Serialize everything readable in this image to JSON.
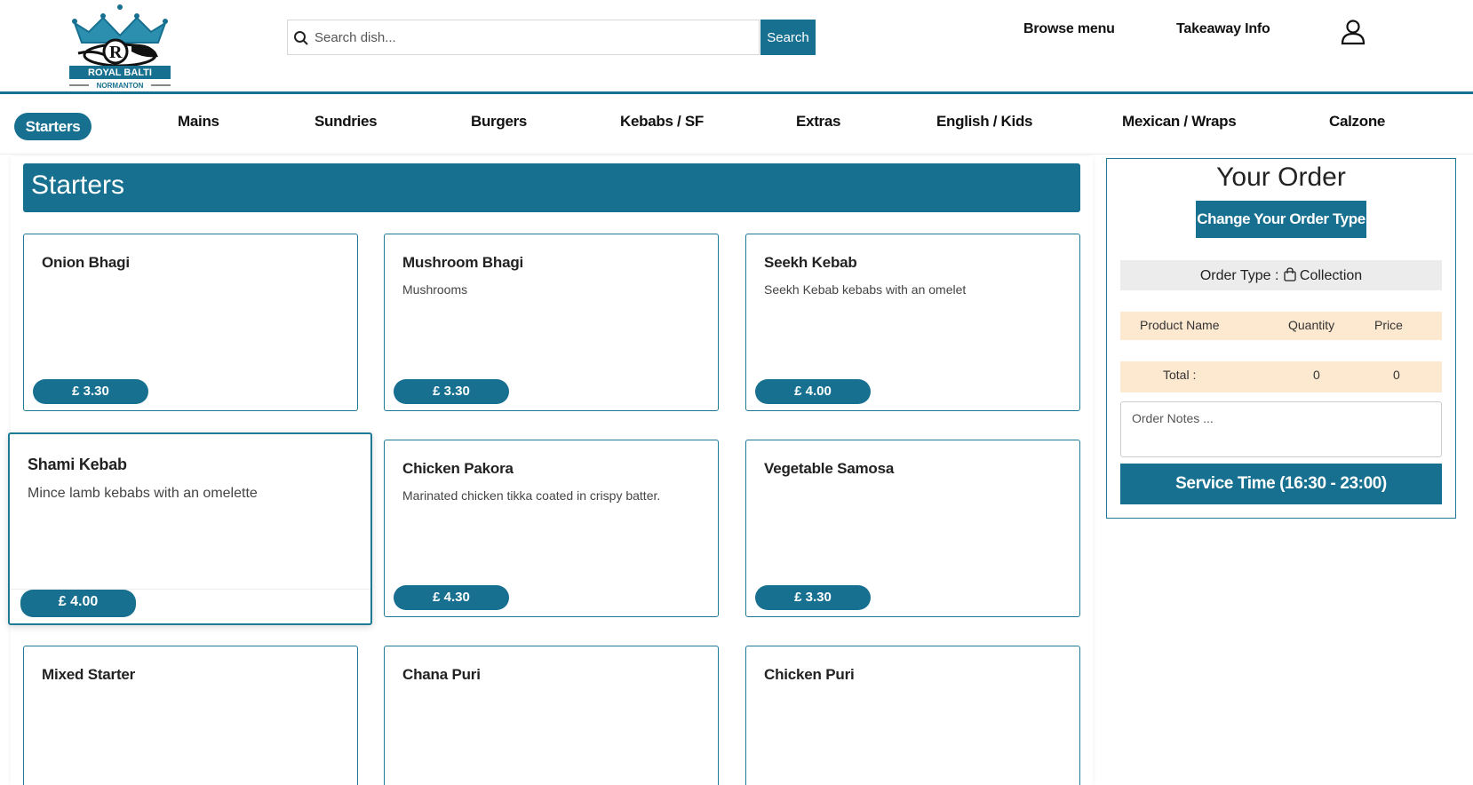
{
  "brand": {
    "name": "ROYAL BALTI",
    "location": "NORMANTON",
    "logo_icon": "crown-logo-icon",
    "accent": "#17708f",
    "header_rule": "#17708f"
  },
  "search": {
    "placeholder": "Search dish...",
    "button_label": "Search",
    "icon": "search-icon"
  },
  "top_nav": {
    "browse_menu": "Browse menu",
    "takeaway_info": "Takeaway Info",
    "account_icon": "user-icon"
  },
  "categories": [
    {
      "label": "Starters",
      "active": true
    },
    {
      "label": "Mains"
    },
    {
      "label": "Sundries"
    },
    {
      "label": "Burgers"
    },
    {
      "label": "Kebabs / SF"
    },
    {
      "label": "Extras"
    },
    {
      "label": "English / Kids"
    },
    {
      "label": "Mexican / Wraps"
    },
    {
      "label": "Calzone"
    }
  ],
  "section": {
    "title": "Starters"
  },
  "dishes": [
    {
      "name": "Onion Bhagi",
      "description": "",
      "price": "£ 3.30"
    },
    {
      "name": "Mushroom Bhagi",
      "description": "Mushrooms",
      "price": "£ 3.30"
    },
    {
      "name": "Seekh Kebab",
      "description": "Seekh Kebab kebabs with an omelet",
      "price": "£ 4.00"
    },
    {
      "name": "Shami Kebab",
      "description": "Mince lamb kebabs with an omelette",
      "price": "£ 4.00",
      "highlighted": true
    },
    {
      "name": "Chicken Pakora",
      "description": "Marinated chicken tikka coated in crispy batter.",
      "price": "£ 4.30"
    },
    {
      "name": "Vegetable Samosa",
      "description": "",
      "price": "£ 3.30"
    },
    {
      "name": "Mixed Starter",
      "description": "",
      "price": ""
    },
    {
      "name": "Chana Puri",
      "description": "",
      "price": ""
    },
    {
      "name": "Chicken Puri",
      "description": "",
      "price": ""
    }
  ],
  "order": {
    "title": "Your Order",
    "change_type_label": "Change Your Order Type",
    "order_type_label": "Order Type :",
    "order_type_value": "Collection",
    "order_type_icon": "shopping-bag-icon",
    "columns": {
      "product": "Product Name",
      "quantity": "Quantity",
      "price": "Price"
    },
    "total_label": "Total :",
    "total_quantity": "0",
    "total_price": "0",
    "notes_placeholder": "Order Notes ...",
    "service_time_label": "Service Time (16:30 - 23:00)"
  }
}
